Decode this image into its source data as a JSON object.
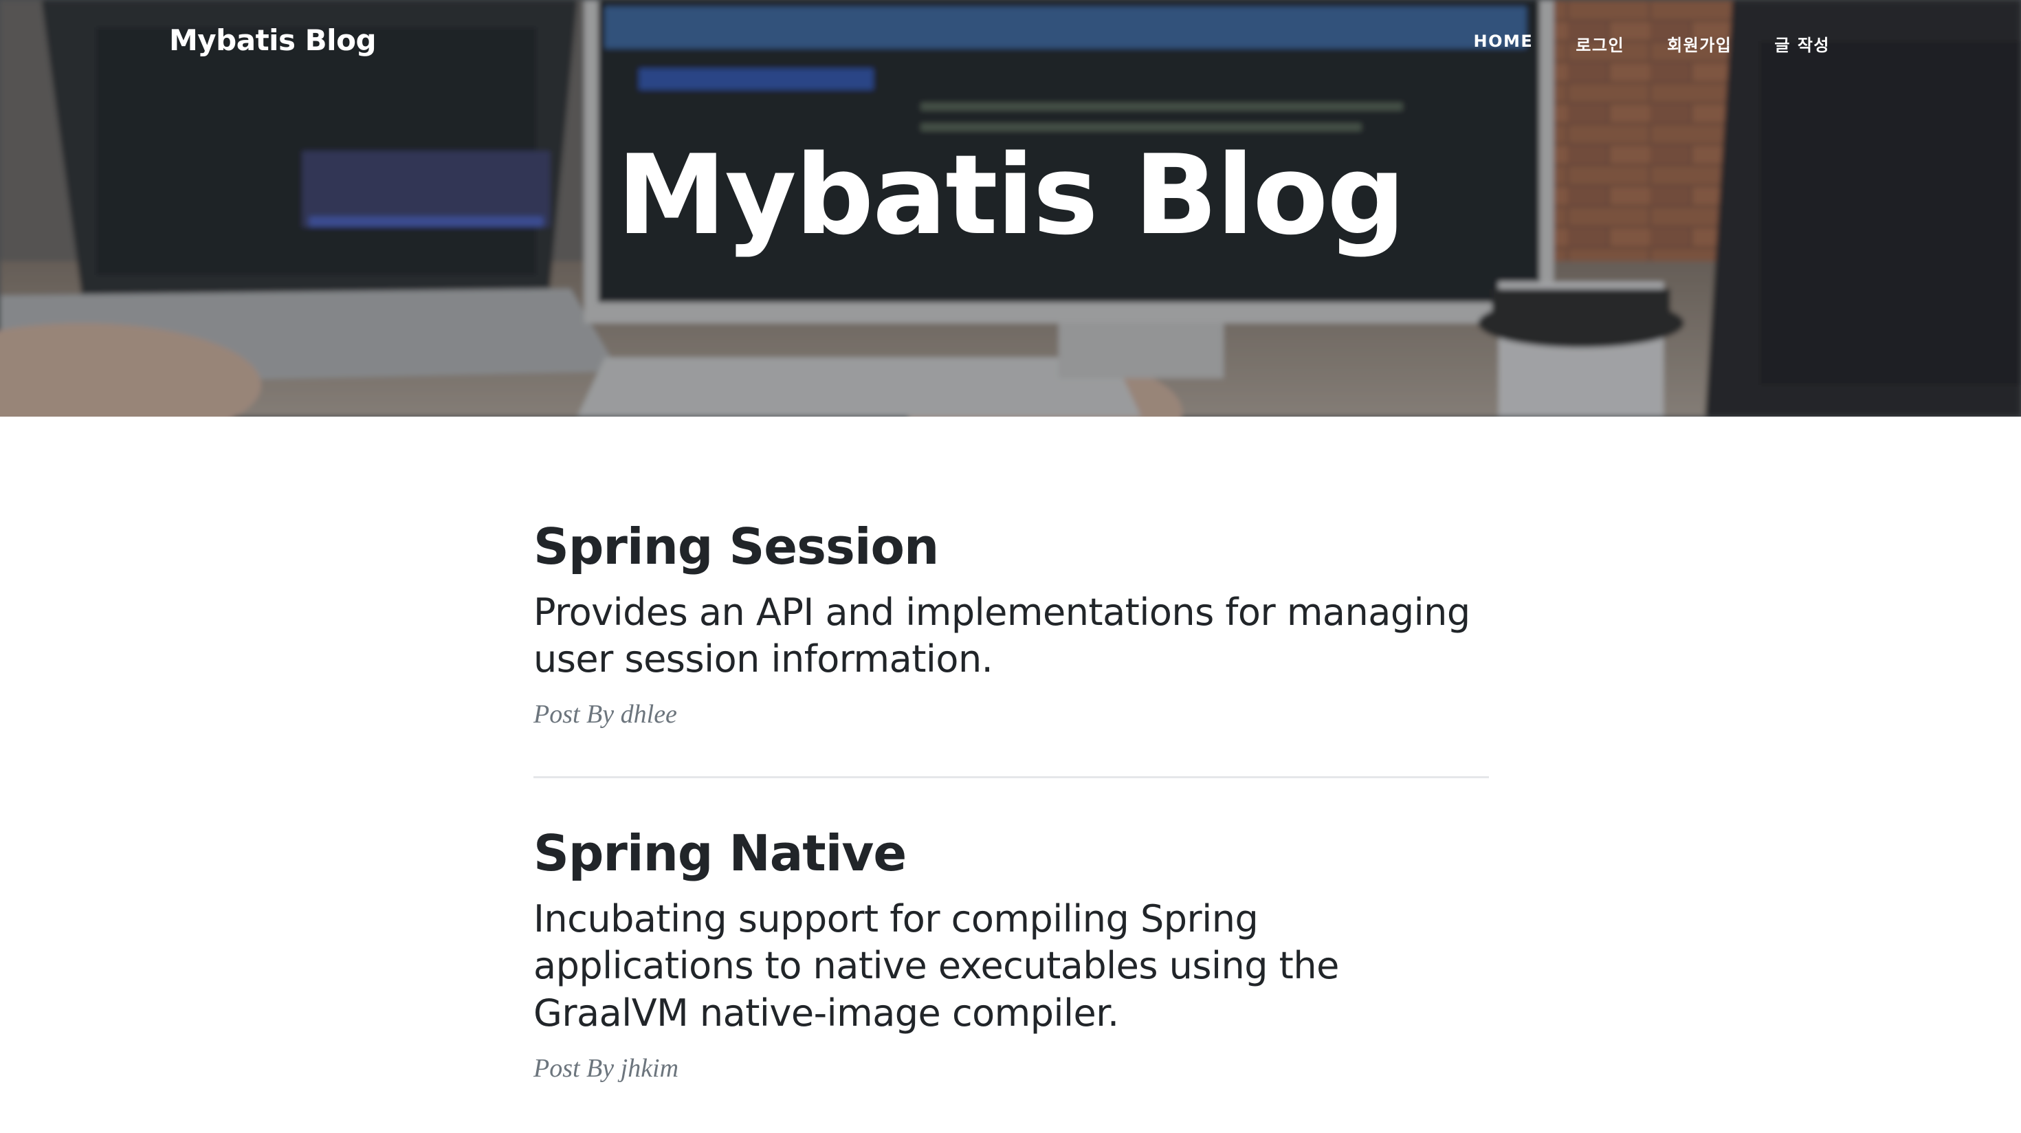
{
  "brand": "Mybatis Blog",
  "nav": {
    "items": [
      {
        "label": "HOME"
      },
      {
        "label": "로그인"
      },
      {
        "label": "회원가입"
      },
      {
        "label": "글 작성"
      }
    ]
  },
  "hero": {
    "title": "Mybatis Blog"
  },
  "posts": [
    {
      "title": "Spring Session",
      "subtitle": "Provides an API and implementations for managing user session information.",
      "meta": "Post By dhlee"
    },
    {
      "title": "Spring Native",
      "subtitle": "Incubating support for compiling Spring applications to native executables using the GraalVM native-image compiler.",
      "meta": "Post By jhkim"
    }
  ],
  "colors": {
    "text_dark": "#212529",
    "meta_gray": "#6c757d",
    "divider": "#e5e7e9",
    "nav_text": "#ffffff"
  }
}
